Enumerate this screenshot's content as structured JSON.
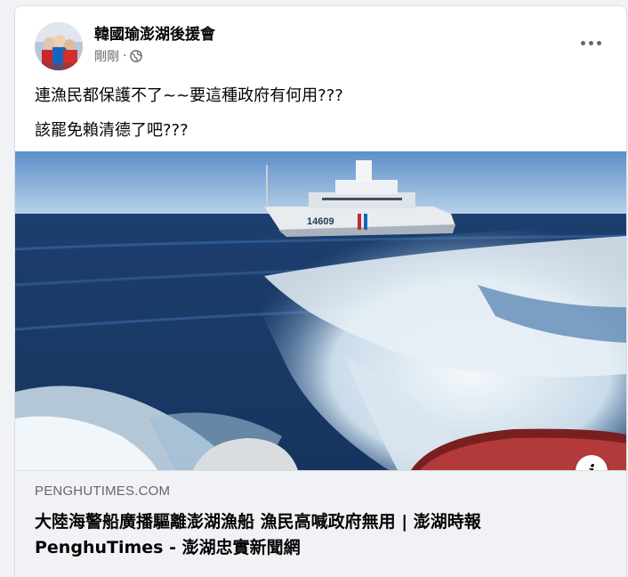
{
  "post": {
    "page_name": "韓國瑜澎湖後援會",
    "timestamp": "剛剛",
    "separator": "·",
    "audience_icon": "globe-icon",
    "more_icon": "more-options-icon",
    "text_lines": [
      "連漁民都保護不了~~要這種政府有何用???",
      "該罷免賴清德了吧???"
    ]
  },
  "link_preview": {
    "domain": "PENGHUTIMES.COM",
    "title_line1": "大陸海警船廣播驅離澎湖漁船 漁民高喊政府無用 | 澎湖時報",
    "title_line2": "PenghuTimes - 澎湖忠實新聞網",
    "info_icon": "i",
    "hull_number": "14609"
  }
}
